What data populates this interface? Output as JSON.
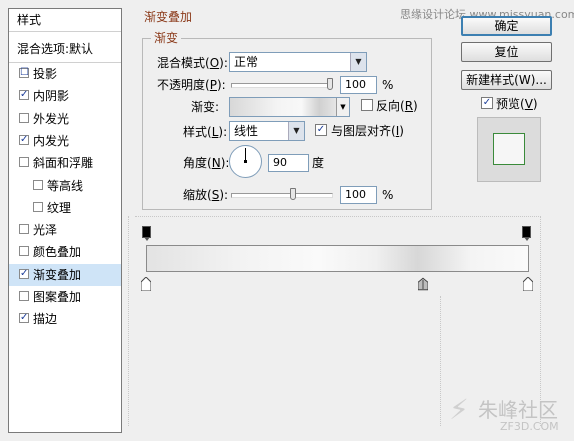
{
  "watermark_top": "思缘设计论坛 www.missyuan.com",
  "watermark_bottom": "朱峰社区",
  "watermark_sub": "ZF3D.COM",
  "styles_panel": {
    "header": "样式",
    "blend_options": "混合选项:默认",
    "items": [
      {
        "label": "投影",
        "checked": false,
        "indent": false,
        "checkbox": "☐"
      },
      {
        "label": "内阴影",
        "checked": true,
        "indent": false,
        "checkbox": "✓"
      },
      {
        "label": "外发光",
        "checked": false,
        "indent": false,
        "checkbox": ""
      },
      {
        "label": "内发光",
        "checked": true,
        "indent": false,
        "checkbox": "✓"
      },
      {
        "label": "斜面和浮雕",
        "checked": false,
        "indent": false,
        "checkbox": ""
      },
      {
        "label": "等高线",
        "checked": false,
        "indent": true,
        "checkbox": ""
      },
      {
        "label": "纹理",
        "checked": false,
        "indent": true,
        "checkbox": ""
      },
      {
        "label": "光泽",
        "checked": false,
        "indent": false,
        "checkbox": ""
      },
      {
        "label": "颜色叠加",
        "checked": false,
        "indent": false,
        "checkbox": ""
      },
      {
        "label": "渐变叠加",
        "checked": true,
        "indent": false,
        "checkbox": "✓",
        "selected": true
      },
      {
        "label": "图案叠加",
        "checked": false,
        "indent": false,
        "checkbox": ""
      },
      {
        "label": "描边",
        "checked": true,
        "indent": false,
        "checkbox": "✓"
      }
    ]
  },
  "gradient_overlay": {
    "title": "渐变叠加",
    "group_title": "渐变",
    "blend_mode": {
      "label": "混合模式",
      "key": "O",
      "value": "正常"
    },
    "opacity": {
      "label": "不透明度",
      "key": "P",
      "value": "100",
      "unit": "%",
      "level": 1.0
    },
    "gradient": {
      "label": "渐变:"
    },
    "reverse": {
      "label": "反向",
      "key": "R",
      "checked": false
    },
    "style": {
      "label": "样式",
      "key": "L",
      "value": "线性"
    },
    "align": {
      "label": "与图层对齐",
      "key": "I",
      "checked": true,
      "mark": "✓"
    },
    "angle": {
      "label": "角度",
      "key": "N",
      "value": "90",
      "unit": "度"
    },
    "scale": {
      "label": "缩放",
      "key": "S",
      "value": "100",
      "unit": "%",
      "level": 0.5
    },
    "arrow": "▼"
  },
  "buttons": {
    "ok": "确定",
    "reset": "复位",
    "new_style": "新建样式(W)...",
    "preview": {
      "label": "预览",
      "key": "V",
      "checked": true,
      "mark": "✓"
    }
  },
  "colors": {
    "selected_row": "#cfe4f7",
    "group_title_text": "#8b3a1a",
    "default_button_border": "#3c7fb1"
  }
}
